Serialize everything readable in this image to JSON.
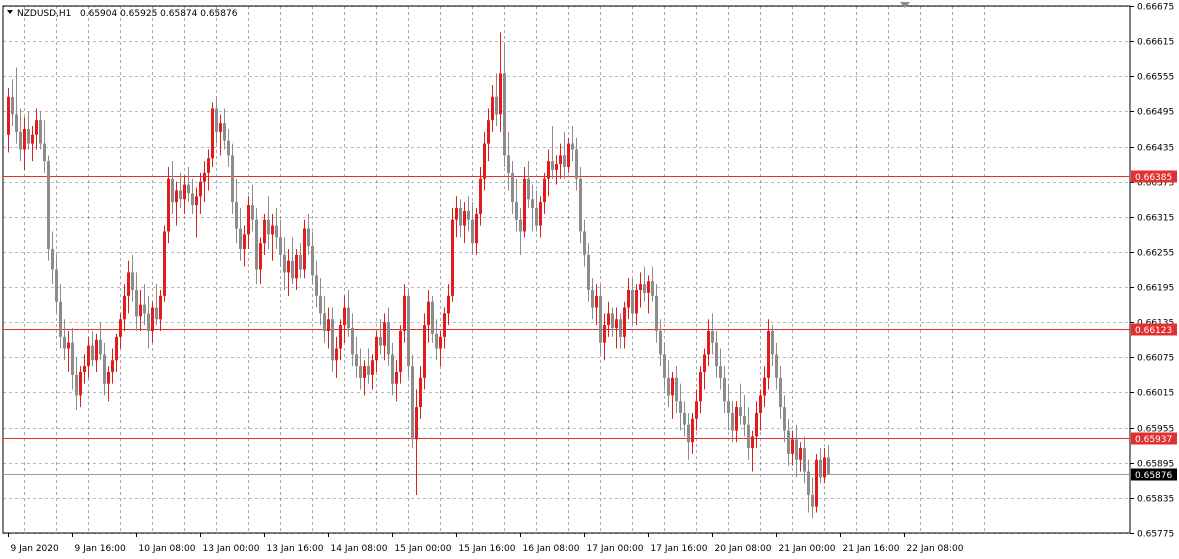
{
  "header": {
    "symbol": "NZDUSD,H1",
    "ohlc": "0.65904 0.65925 0.65874 0.65876"
  },
  "colors": {
    "bull": "#e01c1c",
    "bear": "#8c8c8c",
    "grid": "#000000",
    "level": "#e03030",
    "price_tag": "#000000"
  },
  "chart_data": {
    "type": "candlestick",
    "symbol": "NZDUSD",
    "timeframe": "H1",
    "ylim": [
      0.65775,
      0.66675
    ],
    "y_ticks": [
      "0.66675",
      "0.66615",
      "0.66555",
      "0.66495",
      "0.66435",
      "0.66375",
      "0.66315",
      "0.66255",
      "0.66195",
      "0.66135",
      "0.66075",
      "0.66015",
      "0.65955",
      "0.65895",
      "0.65835",
      "0.65775"
    ],
    "x_tick_labels": [
      "9 Jan 2020",
      "9 Jan 16:00",
      "10 Jan 08:00",
      "13 Jan 00:00",
      "13 Jan 16:00",
      "14 Jan 08:00",
      "15 Jan 00:00",
      "15 Jan 16:00",
      "16 Jan 08:00",
      "17 Jan 00:00",
      "17 Jan 16:00",
      "20 Jan 08:00",
      "21 Jan 00:00",
      "21 Jan 16:00",
      "22 Jan 08:00"
    ],
    "x_tick_bar_index": [
      0,
      16,
      32,
      48,
      64,
      80,
      96,
      112,
      128,
      144,
      160,
      176,
      192,
      208,
      224
    ],
    "levels": [
      {
        "label": "0.66385",
        "value": 0.66385
      },
      {
        "label": "0.66123",
        "value": 0.66123
      },
      {
        "label": "0.65937",
        "value": 0.65937
      }
    ],
    "current_price": {
      "label": "0.65876",
      "value": 0.65876
    },
    "grid": true,
    "ohlc": [
      [
        0.66455,
        0.66535,
        0.66425,
        0.6652
      ],
      [
        0.6652,
        0.6655,
        0.6647,
        0.6649
      ],
      [
        0.6649,
        0.6657,
        0.6644,
        0.6646
      ],
      [
        0.6646,
        0.665,
        0.6641,
        0.6643
      ],
      [
        0.6643,
        0.66485,
        0.66395,
        0.66465
      ],
      [
        0.66465,
        0.66495,
        0.6643,
        0.6644
      ],
      [
        0.6644,
        0.6647,
        0.6641,
        0.66455
      ],
      [
        0.66455,
        0.665,
        0.6643,
        0.6648
      ],
      [
        0.6648,
        0.66495,
        0.6643,
        0.6644
      ],
      [
        0.6644,
        0.6648,
        0.6639,
        0.6641
      ],
      [
        0.6641,
        0.6642,
        0.6624,
        0.6626
      ],
      [
        0.6626,
        0.6629,
        0.662,
        0.66225
      ],
      [
        0.66225,
        0.6625,
        0.6615,
        0.6617
      ],
      [
        0.6617,
        0.662,
        0.6609,
        0.6611
      ],
      [
        0.6611,
        0.6614,
        0.6607,
        0.6609
      ],
      [
        0.6609,
        0.6612,
        0.6605,
        0.661
      ],
      [
        0.661,
        0.66125,
        0.6602,
        0.66045
      ],
      [
        0.66045,
        0.66075,
        0.65985,
        0.6601
      ],
      [
        0.6601,
        0.6606,
        0.6599,
        0.6605
      ],
      [
        0.6605,
        0.6608,
        0.6603,
        0.6606
      ],
      [
        0.6606,
        0.6611,
        0.6604,
        0.66095
      ],
      [
        0.66095,
        0.6612,
        0.6606,
        0.6607
      ],
      [
        0.6607,
        0.66115,
        0.6605,
        0.66105
      ],
      [
        0.66105,
        0.66135,
        0.6607,
        0.6608
      ],
      [
        0.6608,
        0.661,
        0.6601,
        0.6603
      ],
      [
        0.6603,
        0.6606,
        0.66,
        0.6605
      ],
      [
        0.6605,
        0.6609,
        0.6603,
        0.6607
      ],
      [
        0.6607,
        0.66115,
        0.6605,
        0.6611
      ],
      [
        0.6611,
        0.6615,
        0.6609,
        0.6614
      ],
      [
        0.6614,
        0.662,
        0.6612,
        0.6618
      ],
      [
        0.6618,
        0.6624,
        0.6615,
        0.6622
      ],
      [
        0.6622,
        0.6625,
        0.6617,
        0.6619
      ],
      [
        0.6619,
        0.6622,
        0.6612,
        0.66145
      ],
      [
        0.66145,
        0.6619,
        0.6612,
        0.66165
      ],
      [
        0.66165,
        0.662,
        0.6613,
        0.6615
      ],
      [
        0.6615,
        0.6618,
        0.6609,
        0.6612
      ],
      [
        0.6612,
        0.6617,
        0.661,
        0.6616
      ],
      [
        0.6616,
        0.662,
        0.6613,
        0.6614
      ],
      [
        0.6614,
        0.6619,
        0.6612,
        0.6618
      ],
      [
        0.6618,
        0.663,
        0.6617,
        0.6629
      ],
      [
        0.6629,
        0.664,
        0.6627,
        0.6638
      ],
      [
        0.6638,
        0.6641,
        0.6632,
        0.6634
      ],
      [
        0.6634,
        0.66375,
        0.663,
        0.6636
      ],
      [
        0.6636,
        0.6639,
        0.6633,
        0.66345
      ],
      [
        0.66345,
        0.66385,
        0.6632,
        0.6637
      ],
      [
        0.6637,
        0.664,
        0.6634,
        0.66355
      ],
      [
        0.66355,
        0.6638,
        0.6632,
        0.66335
      ],
      [
        0.66335,
        0.66365,
        0.6628,
        0.6635
      ],
      [
        0.6635,
        0.6639,
        0.6632,
        0.66375
      ],
      [
        0.66375,
        0.6641,
        0.6634,
        0.6639
      ],
      [
        0.6639,
        0.6643,
        0.6636,
        0.66415
      ],
      [
        0.66415,
        0.6651,
        0.664,
        0.665
      ],
      [
        0.665,
        0.6652,
        0.6644,
        0.6646
      ],
      [
        0.6646,
        0.6649,
        0.6642,
        0.66475
      ],
      [
        0.66475,
        0.665,
        0.6643,
        0.66445
      ],
      [
        0.66445,
        0.66465,
        0.664,
        0.6642
      ],
      [
        0.6642,
        0.6644,
        0.6632,
        0.6634
      ],
      [
        0.6634,
        0.6638,
        0.6627,
        0.66295
      ],
      [
        0.66295,
        0.6633,
        0.6624,
        0.6626
      ],
      [
        0.6626,
        0.663,
        0.6623,
        0.66285
      ],
      [
        0.66285,
        0.6635,
        0.6626,
        0.66335
      ],
      [
        0.66335,
        0.6637,
        0.6629,
        0.6631
      ],
      [
        0.6631,
        0.6633,
        0.662,
        0.66225
      ],
      [
        0.66225,
        0.6628,
        0.662,
        0.6627
      ],
      [
        0.6627,
        0.6632,
        0.6625,
        0.6631
      ],
      [
        0.6631,
        0.6635,
        0.6626,
        0.66285
      ],
      [
        0.66285,
        0.6632,
        0.6624,
        0.663
      ],
      [
        0.663,
        0.6633,
        0.6626,
        0.6628
      ],
      [
        0.6628,
        0.6631,
        0.6623,
        0.6625
      ],
      [
        0.6625,
        0.6628,
        0.6619,
        0.6622
      ],
      [
        0.6622,
        0.6626,
        0.6618,
        0.6624
      ],
      [
        0.6624,
        0.6628,
        0.662,
        0.6621
      ],
      [
        0.6621,
        0.6626,
        0.6619,
        0.6625
      ],
      [
        0.6625,
        0.6627,
        0.6621,
        0.66225
      ],
      [
        0.66225,
        0.6631,
        0.6621,
        0.66295
      ],
      [
        0.66295,
        0.6632,
        0.6625,
        0.66265
      ],
      [
        0.66265,
        0.6629,
        0.662,
        0.66215
      ],
      [
        0.66215,
        0.6624,
        0.6616,
        0.6618
      ],
      [
        0.6618,
        0.6621,
        0.6613,
        0.6615
      ],
      [
        0.6615,
        0.6618,
        0.661,
        0.6612
      ],
      [
        0.6612,
        0.6616,
        0.6609,
        0.6614
      ],
      [
        0.6614,
        0.6616,
        0.6605,
        0.6607
      ],
      [
        0.6607,
        0.6611,
        0.6604,
        0.6609
      ],
      [
        0.6609,
        0.6614,
        0.6607,
        0.6613
      ],
      [
        0.6613,
        0.6618,
        0.661,
        0.6616
      ],
      [
        0.6616,
        0.6619,
        0.6611,
        0.66125
      ],
      [
        0.66125,
        0.6615,
        0.6606,
        0.6608
      ],
      [
        0.6608,
        0.6611,
        0.6604,
        0.6606
      ],
      [
        0.6606,
        0.6609,
        0.6602,
        0.6604
      ],
      [
        0.6604,
        0.6607,
        0.6601,
        0.6606
      ],
      [
        0.6606,
        0.6609,
        0.6603,
        0.66045
      ],
      [
        0.66045,
        0.6608,
        0.6602,
        0.6607
      ],
      [
        0.6607,
        0.6612,
        0.6605,
        0.6611
      ],
      [
        0.6611,
        0.6614,
        0.6608,
        0.66095
      ],
      [
        0.66095,
        0.6615,
        0.6607,
        0.66135
      ],
      [
        0.66135,
        0.6616,
        0.6606,
        0.6608
      ],
      [
        0.6608,
        0.661,
        0.6601,
        0.6603
      ],
      [
        0.6603,
        0.6607,
        0.66,
        0.6605
      ],
      [
        0.6605,
        0.6613,
        0.6603,
        0.6612
      ],
      [
        0.6612,
        0.662,
        0.661,
        0.6618
      ],
      [
        0.6618,
        0.6619,
        0.6604,
        0.6606
      ],
      [
        0.6606,
        0.6608,
        0.6592,
        0.65935
      ],
      [
        0.65935,
        0.6602,
        0.6584,
        0.6599
      ],
      [
        0.6599,
        0.6606,
        0.6597,
        0.6604
      ],
      [
        0.6604,
        0.6615,
        0.6602,
        0.6613
      ],
      [
        0.6613,
        0.6619,
        0.661,
        0.6617
      ],
      [
        0.6617,
        0.6618,
        0.661,
        0.66115
      ],
      [
        0.66115,
        0.6614,
        0.6607,
        0.6609
      ],
      [
        0.6609,
        0.6612,
        0.6606,
        0.6611
      ],
      [
        0.6611,
        0.6616,
        0.6609,
        0.6615
      ],
      [
        0.6615,
        0.662,
        0.6613,
        0.6618
      ],
      [
        0.6618,
        0.6633,
        0.6617,
        0.6631
      ],
      [
        0.6631,
        0.6635,
        0.6628,
        0.6633
      ],
      [
        0.6633,
        0.66345,
        0.6628,
        0.663
      ],
      [
        0.663,
        0.6634,
        0.6627,
        0.66325
      ],
      [
        0.66325,
        0.6635,
        0.6629,
        0.6631
      ],
      [
        0.6631,
        0.6634,
        0.6625,
        0.6627
      ],
      [
        0.6627,
        0.6633,
        0.6625,
        0.6632
      ],
      [
        0.6632,
        0.664,
        0.663,
        0.6638
      ],
      [
        0.6638,
        0.6646,
        0.6636,
        0.6644
      ],
      [
        0.6644,
        0.665,
        0.6641,
        0.6648
      ],
      [
        0.6648,
        0.6654,
        0.6646,
        0.6652
      ],
      [
        0.6652,
        0.6656,
        0.6647,
        0.6649
      ],
      [
        0.6649,
        0.6663,
        0.6646,
        0.6656
      ],
      [
        0.6656,
        0.6661,
        0.664,
        0.6642
      ],
      [
        0.6642,
        0.6646,
        0.6636,
        0.6639
      ],
      [
        0.6639,
        0.6641,
        0.6632,
        0.6634
      ],
      [
        0.6634,
        0.6638,
        0.6629,
        0.6631
      ],
      [
        0.6631,
        0.6633,
        0.6625,
        0.6629
      ],
      [
        0.6629,
        0.664,
        0.6628,
        0.6638
      ],
      [
        0.6638,
        0.6641,
        0.6633,
        0.66345
      ],
      [
        0.66345,
        0.6637,
        0.6629,
        0.6633
      ],
      [
        0.6633,
        0.6636,
        0.6629,
        0.663
      ],
      [
        0.663,
        0.6635,
        0.6628,
        0.6634
      ],
      [
        0.6634,
        0.6639,
        0.6632,
        0.6638
      ],
      [
        0.6638,
        0.6643,
        0.6635,
        0.6641
      ],
      [
        0.6641,
        0.6647,
        0.6638,
        0.66395
      ],
      [
        0.66395,
        0.6642,
        0.6637,
        0.66405
      ],
      [
        0.66405,
        0.6644,
        0.6638,
        0.6642
      ],
      [
        0.6642,
        0.6646,
        0.6638,
        0.664
      ],
      [
        0.664,
        0.6645,
        0.6639,
        0.6644
      ],
      [
        0.6644,
        0.6647,
        0.6641,
        0.6643
      ],
      [
        0.6643,
        0.6645,
        0.6636,
        0.6638
      ],
      [
        0.6638,
        0.664,
        0.6627,
        0.6629
      ],
      [
        0.6629,
        0.6631,
        0.6623,
        0.6625
      ],
      [
        0.6625,
        0.6627,
        0.6617,
        0.6619
      ],
      [
        0.6619,
        0.6621,
        0.6614,
        0.6616
      ],
      [
        0.6616,
        0.662,
        0.6613,
        0.6618
      ],
      [
        0.6618,
        0.662,
        0.6608,
        0.661
      ],
      [
        0.661,
        0.6615,
        0.6607,
        0.6613
      ],
      [
        0.6613,
        0.6617,
        0.6611,
        0.6615
      ],
      [
        0.6615,
        0.6616,
        0.6611,
        0.66125
      ],
      [
        0.66125,
        0.6616,
        0.6609,
        0.6614
      ],
      [
        0.6614,
        0.6615,
        0.6609,
        0.6611
      ],
      [
        0.6611,
        0.6617,
        0.6609,
        0.6616
      ],
      [
        0.6616,
        0.6621,
        0.6614,
        0.6619
      ],
      [
        0.6619,
        0.6621,
        0.6613,
        0.6615
      ],
      [
        0.6615,
        0.662,
        0.6613,
        0.6619
      ],
      [
        0.6619,
        0.6622,
        0.6616,
        0.662
      ],
      [
        0.662,
        0.6623,
        0.6617,
        0.66185
      ],
      [
        0.66185,
        0.66215,
        0.6615,
        0.66205
      ],
      [
        0.66205,
        0.6623,
        0.6617,
        0.6618
      ],
      [
        0.6618,
        0.662,
        0.661,
        0.6612
      ],
      [
        0.6612,
        0.6614,
        0.6606,
        0.6608
      ],
      [
        0.6608,
        0.661,
        0.6602,
        0.6604
      ],
      [
        0.6604,
        0.6607,
        0.6599,
        0.6601
      ],
      [
        0.6601,
        0.6605,
        0.6597,
        0.6604
      ],
      [
        0.6604,
        0.6606,
        0.6598,
        0.66
      ],
      [
        0.66,
        0.6603,
        0.6595,
        0.6598
      ],
      [
        0.6598,
        0.66,
        0.6594,
        0.6596
      ],
      [
        0.6596,
        0.6598,
        0.659,
        0.6593
      ],
      [
        0.6593,
        0.6598,
        0.6591,
        0.6597
      ],
      [
        0.6597,
        0.6602,
        0.6595,
        0.66
      ],
      [
        0.66,
        0.6606,
        0.6598,
        0.6605
      ],
      [
        0.6605,
        0.6609,
        0.6602,
        0.6608
      ],
      [
        0.6608,
        0.6614,
        0.6606,
        0.6612
      ],
      [
        0.6612,
        0.6615,
        0.6608,
        0.661
      ],
      [
        0.661,
        0.6612,
        0.6604,
        0.6606
      ],
      [
        0.6606,
        0.6609,
        0.6602,
        0.6604
      ],
      [
        0.6604,
        0.6606,
        0.6598,
        0.66
      ],
      [
        0.66,
        0.6603,
        0.6595,
        0.6598
      ],
      [
        0.6598,
        0.66,
        0.6593,
        0.6595
      ],
      [
        0.6595,
        0.66,
        0.6593,
        0.6599
      ],
      [
        0.6599,
        0.6603,
        0.6596,
        0.65975
      ],
      [
        0.65975,
        0.6601,
        0.6594,
        0.6596
      ],
      [
        0.6596,
        0.6599,
        0.659,
        0.6592
      ],
      [
        0.6592,
        0.6595,
        0.6588,
        0.6594
      ],
      [
        0.6594,
        0.66,
        0.6592,
        0.6598
      ],
      [
        0.6598,
        0.6602,
        0.6595,
        0.6601
      ],
      [
        0.6601,
        0.6606,
        0.6599,
        0.6604
      ],
      [
        0.6604,
        0.6614,
        0.6602,
        0.6612
      ],
      [
        0.6612,
        0.6613,
        0.6606,
        0.6608
      ],
      [
        0.6608,
        0.661,
        0.6602,
        0.6604
      ],
      [
        0.6604,
        0.6606,
        0.6597,
        0.6599
      ],
      [
        0.6599,
        0.6601,
        0.6593,
        0.6595
      ],
      [
        0.6595,
        0.6597,
        0.6589,
        0.6591
      ],
      [
        0.6591,
        0.6595,
        0.6589,
        0.65935
      ],
      [
        0.65935,
        0.6596,
        0.6587,
        0.659
      ],
      [
        0.659,
        0.6593,
        0.6588,
        0.6592
      ],
      [
        0.6592,
        0.6594,
        0.6586,
        0.6588
      ],
      [
        0.6588,
        0.659,
        0.6581,
        0.6584
      ],
      [
        0.6584,
        0.6587,
        0.658,
        0.6582
      ],
      [
        0.6582,
        0.6591,
        0.6581,
        0.659
      ],
      [
        0.659,
        0.6592,
        0.6586,
        0.6587
      ],
      [
        0.6587,
        0.6592,
        0.6586,
        0.65904
      ],
      [
        0.65904,
        0.65925,
        0.65874,
        0.65876
      ]
    ]
  }
}
